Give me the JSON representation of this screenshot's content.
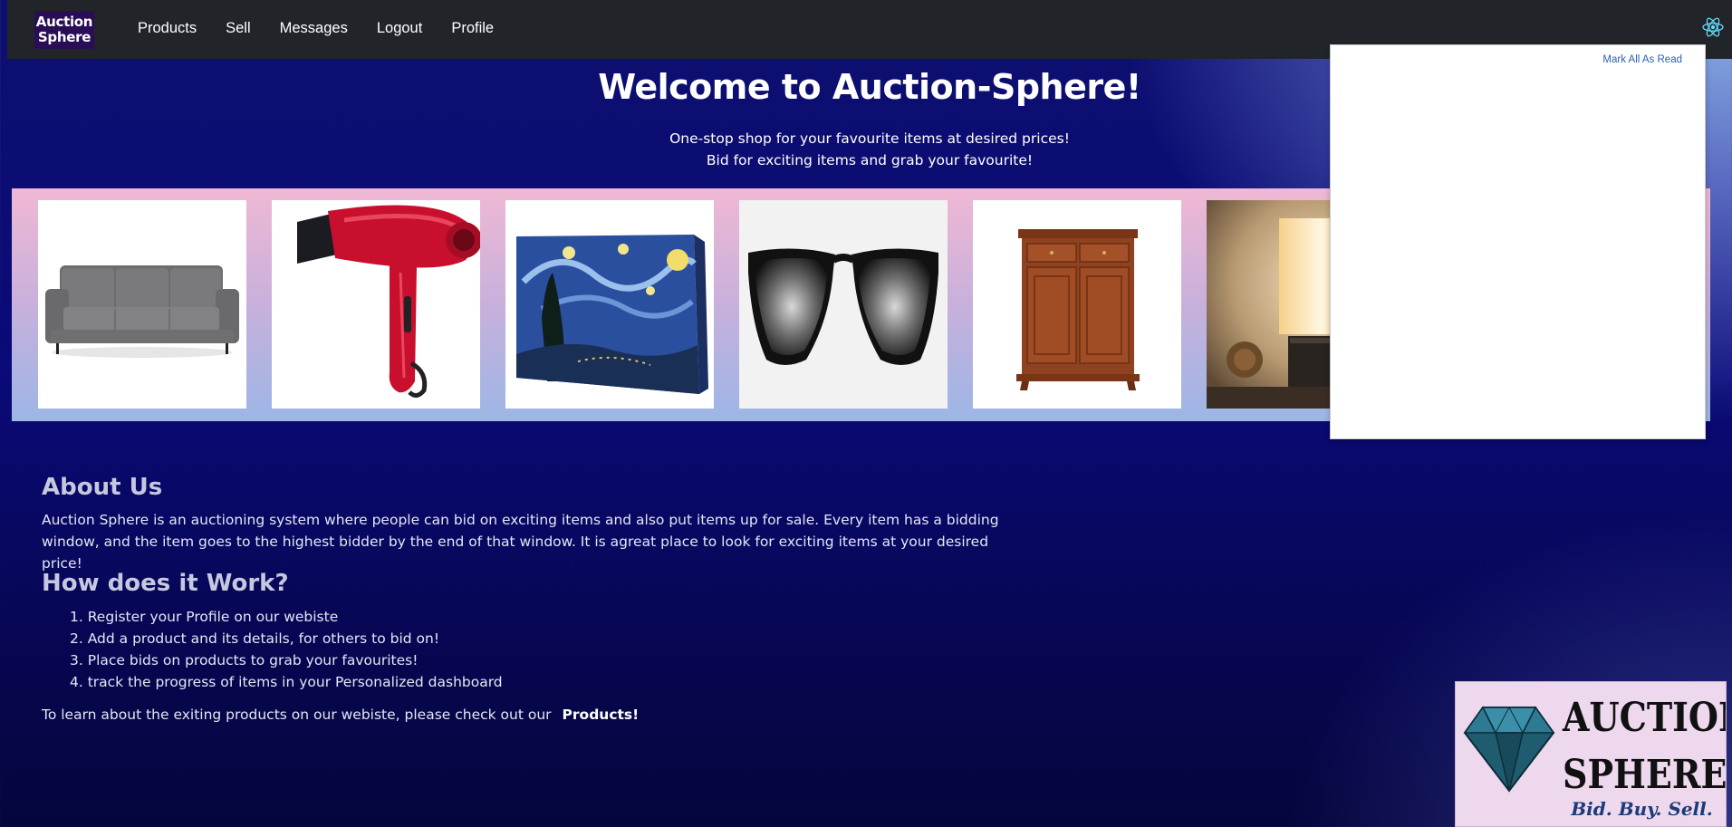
{
  "navbar": {
    "brand_line1": "Auction",
    "brand_line2": "Sphere",
    "links": [
      "Products",
      "Sell",
      "Messages",
      "Logout",
      "Profile"
    ],
    "notification_icon": "react-atom-icon"
  },
  "hero": {
    "title": "Welcome to Auction-Sphere!",
    "subtitle_line1": "One-stop shop for your favourite items at desired prices!",
    "subtitle_line2": "Bid for exciting items and grab your favourite!"
  },
  "carousel": {
    "items": [
      "sofa",
      "hair dryer",
      "starry night painting",
      "sunglasses",
      "wooden cabinet",
      "table lamp"
    ]
  },
  "notifications": {
    "mark_all_label": "Mark All As Read"
  },
  "about": {
    "heading": "About Us",
    "text": "Auction Sphere is an auctioning system where people can bid on exciting items and also put items up for sale. Every item has a bidding window, and the item goes to the highest bidder by the end of that window. It is agreat place to look for exciting items at your desired price!"
  },
  "how": {
    "heading": "How does it Work?",
    "steps": [
      "1. Register your Profile on our webiste",
      "2. Add a product and its details, for others to bid on!",
      "3. Place bids on products to grab your favourites!",
      "4. track the progress of items in your Personalized dashboard"
    ]
  },
  "cta": {
    "text": "To learn about the exiting products on our webiste, please check out our",
    "link": "Products!"
  },
  "logo": {
    "line1": "AUCTION",
    "line2": "SPHERE",
    "tagline": "Bid. Buy. Sell."
  },
  "colors": {
    "navbar_bg": "#212529",
    "background_dark": "#0a0a78",
    "link_blue": "#2a5fb0"
  }
}
